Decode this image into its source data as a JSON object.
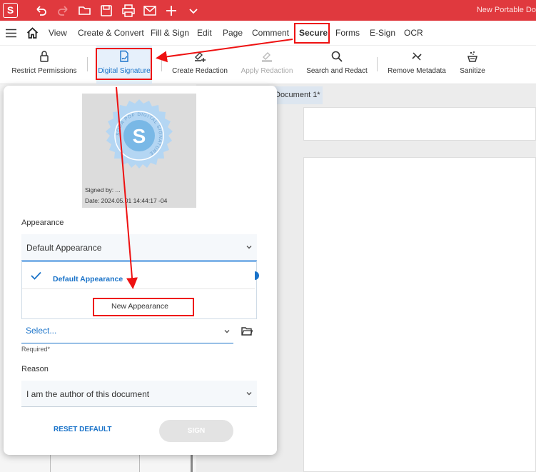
{
  "titlebar": {
    "logo": "S",
    "title": "New Portable Do",
    "icons": [
      "undo-icon",
      "redo-icon",
      "open-icon",
      "save-icon",
      "print-icon",
      "mail-icon",
      "add-icon",
      "more-icon"
    ]
  },
  "menu": {
    "items": [
      "View",
      "Create & Convert",
      "Fill & Sign",
      "Edit",
      "Page",
      "Comment",
      "Secure",
      "Forms",
      "E-Sign",
      "OCR"
    ],
    "active": "Secure"
  },
  "ribbon": {
    "items": [
      {
        "label": "Restrict Permissions",
        "icon": "lock-icon"
      },
      {
        "label": "Digital Signature",
        "icon": "signature-icon",
        "active": true
      },
      {
        "label": "Create Redaction",
        "icon": "redaction-icon"
      },
      {
        "label": "Apply Redaction",
        "icon": "apply-redaction-icon",
        "disabled": true
      },
      {
        "label": "Search and Redact",
        "icon": "search-icon"
      },
      {
        "label": "Remove Metadata",
        "icon": "remove-metadata-icon"
      },
      {
        "label": "Sanitize",
        "icon": "sanitize-icon"
      }
    ]
  },
  "document": {
    "tab": "Document 1*"
  },
  "panel": {
    "preview": {
      "seal_letter": "S",
      "seal_ring_text": "SODA PDF DIGITAL SIGNATURE",
      "signed_by": "Signed by: ...",
      "date": "Date: 2024.05.01 14:44:17 -04"
    },
    "appearance": {
      "label": "Appearance",
      "value": "Default Appearance",
      "options": [
        "Default Appearance",
        "New Appearance"
      ]
    },
    "certificate": {
      "placeholder": "Select...",
      "required": "Required*"
    },
    "reason": {
      "label": "Reason",
      "value": "I am the author of this document"
    },
    "reset_label": "RESET DEFAULT",
    "sign_label": "SIGN"
  },
  "colors": {
    "brand_red": "#e0393e",
    "accent_blue": "#1a73c9",
    "annotation_red": "#ee1111"
  }
}
